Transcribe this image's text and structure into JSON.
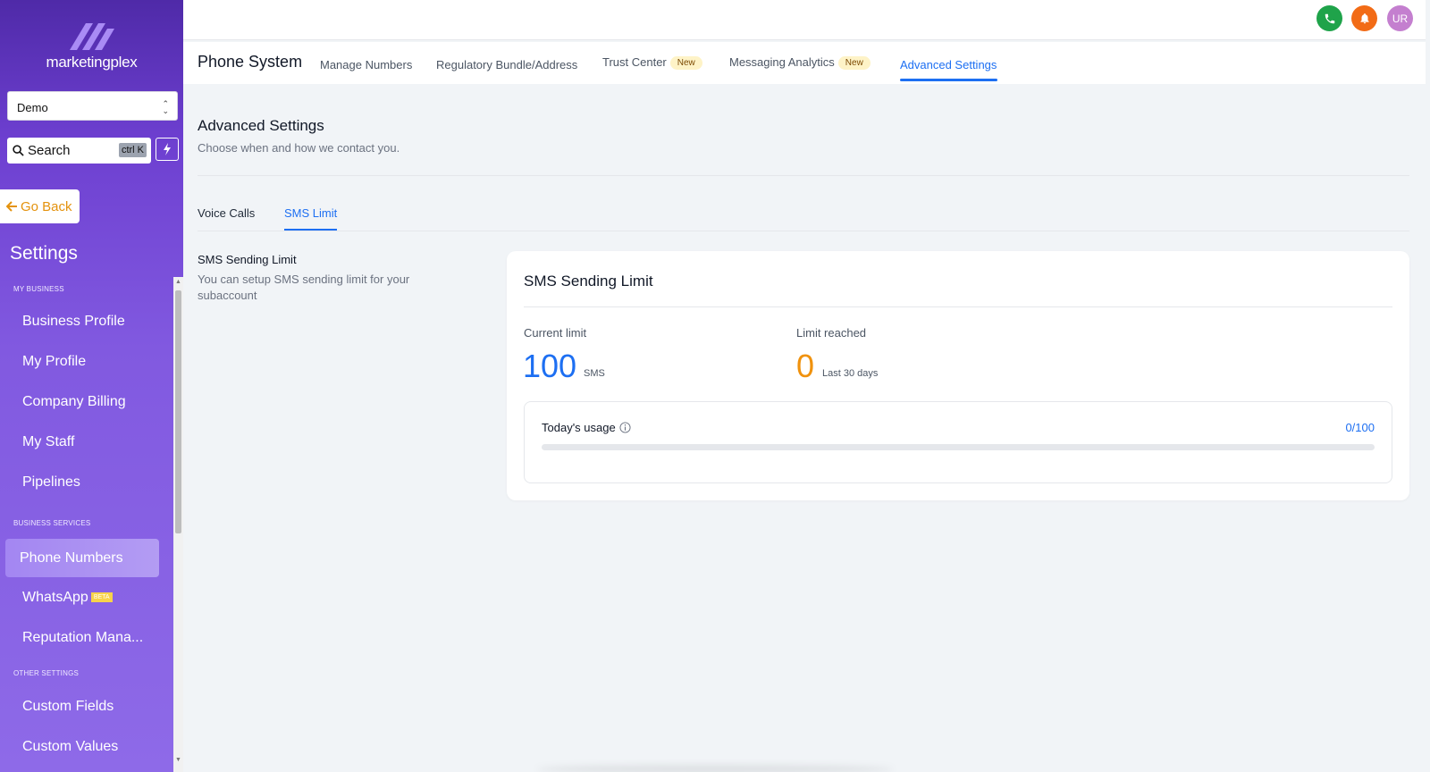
{
  "sidebar": {
    "logo_text": "marketingplex",
    "location": "Demo",
    "search_label": "Search",
    "search_shortcut": "ctrl K",
    "go_back": "Go Back",
    "settings_title": "Settings",
    "sections": {
      "my_business": "MY BUSINESS",
      "business_services": "BUSINESS SERVICES",
      "other_settings": "OTHER SETTINGS"
    },
    "items": {
      "business_profile": "Business Profile",
      "my_profile": "My Profile",
      "company_billing": "Company Billing",
      "my_staff": "My Staff",
      "pipelines": "Pipelines",
      "phone_numbers": "Phone Numbers",
      "whatsapp": "WhatsApp",
      "whatsapp_badge": "BETA",
      "reputation": "Reputation Mana...",
      "custom_fields": "Custom Fields",
      "custom_values": "Custom Values"
    }
  },
  "header": {
    "avatar_initials": "UR",
    "colors": {
      "phone": "#1fa34a",
      "bell": "#f26b16",
      "avatar": "#c47fcf"
    }
  },
  "subnav": {
    "title": "Phone System",
    "tabs": {
      "manage_numbers": "Manage Numbers",
      "regulatory": "Regulatory Bundle/Address",
      "trust_center": "Trust Center",
      "messaging_analytics": "Messaging Analytics",
      "advanced_settings": "Advanced Settings"
    },
    "new_badge": "New"
  },
  "main": {
    "title": "Advanced Settings",
    "subtitle": "Choose when and how we contact you.",
    "tabs": {
      "voice_calls": "Voice Calls",
      "sms_limit": "SMS Limit"
    },
    "section_head": "SMS Sending Limit",
    "section_desc": "You can setup SMS sending limit for your subaccount",
    "card": {
      "title": "SMS Sending Limit",
      "current_limit_label": "Current limit",
      "current_limit_value": "100",
      "current_limit_unit": "SMS",
      "limit_reached_label": "Limit reached",
      "limit_reached_value": "0",
      "limit_reached_unit": "Last 30 days",
      "usage_label": "Today's usage",
      "usage_value": "0/100",
      "usage_fraction": 0
    }
  },
  "accent_colors": {
    "blue": "#1d6ff2",
    "orange": "#f0920e"
  }
}
